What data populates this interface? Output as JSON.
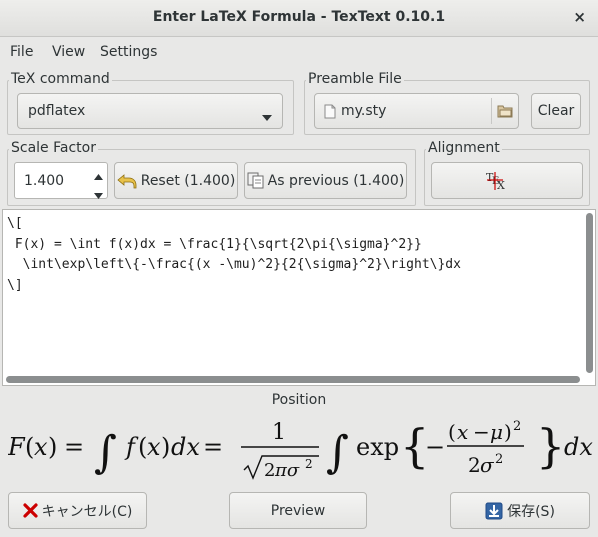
{
  "window": {
    "title": "Enter LaTeX Formula - TexText 0.10.1",
    "close_glyph": "×"
  },
  "menu": {
    "file": "File",
    "view": "View",
    "settings": "Settings"
  },
  "tex_command": {
    "label": "TeX command",
    "value": "pdflatex"
  },
  "preamble": {
    "label": "Preamble File",
    "value": "my.sty",
    "clear_label": "Clear"
  },
  "scale": {
    "label": "Scale Factor",
    "value": "1.400",
    "reset_label": "Reset (1.400)",
    "as_previous_label": "As previous (1.400)"
  },
  "alignment": {
    "label": "Alignment"
  },
  "editor": {
    "lines": [
      "\\[",
      " F(x) = \\int f(x)dx = \\frac{1}{\\sqrt{2\\pi{\\sigma}^2}}",
      "  \\int\\exp\\left\\{-\\frac{(x -\\mu)^2}{2{\\sigma}^2}\\right\\}dx",
      "\\]"
    ]
  },
  "position_label": "Position",
  "buttons": {
    "cancel": "キャンセル(C)",
    "preview": "Preview",
    "save": "保存(S)"
  },
  "colors": {
    "window_bg": "#e8e8e7",
    "cancel_icon": "#cc0000",
    "save_icon": "#3465a4"
  }
}
